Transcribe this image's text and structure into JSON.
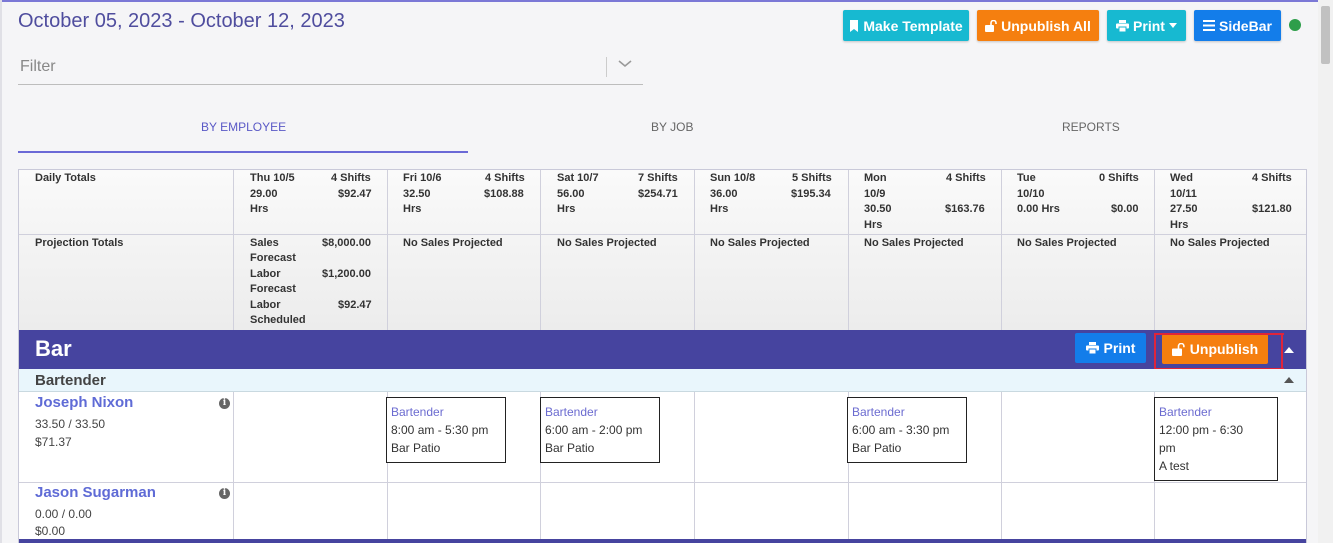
{
  "header": {
    "date_range": "October 05, 2023 - October 12, 2023",
    "buttons": {
      "make_template": "Make Template",
      "unpublish_all": "Unpublish All",
      "print": "Print",
      "sidebar": "SideBar"
    }
  },
  "filter": {
    "placeholder": "Filter"
  },
  "tabs": [
    {
      "label": "BY EMPLOYEE",
      "active": true
    },
    {
      "label": "BY JOB",
      "active": false
    },
    {
      "label": "REPORTS",
      "active": false
    }
  ],
  "daily_totals": {
    "label": "Daily Totals",
    "days": [
      {
        "day": "Thu 10/5",
        "shifts": "4 Shifts",
        "hrs_value": "29.00",
        "hrs_unit": "Hrs",
        "amount": "$92.47"
      },
      {
        "day": "Fri 10/6",
        "shifts": "4 Shifts",
        "hrs_value": "32.50",
        "hrs_unit": "Hrs",
        "amount": "$108.88"
      },
      {
        "day": "Sat 10/7",
        "shifts": "7 Shifts",
        "hrs_value": "56.00",
        "hrs_unit": "Hrs",
        "amount": "$254.71"
      },
      {
        "day": "Sun 10/8",
        "shifts": "5 Shifts",
        "hrs_value": "36.00",
        "hrs_unit": "Hrs",
        "amount": "$195.34"
      },
      {
        "day": "Mon",
        "day2": "10/9",
        "shifts": "4 Shifts",
        "hrs_value": "30.50",
        "hrs_unit": "Hrs",
        "amount": "$163.76"
      },
      {
        "day": "Tue",
        "day2": "10/10",
        "shifts": "0 Shifts",
        "hrs_value": "0.00 Hrs",
        "amount": "$0.00"
      },
      {
        "day": "Wed",
        "day2": "10/11",
        "shifts": "4 Shifts",
        "hrs_value": "27.50",
        "hrs_unit": "Hrs",
        "amount": "$121.80"
      }
    ]
  },
  "projection_totals": {
    "label": "Projection Totals",
    "first_day": {
      "sales_l1": "Sales",
      "sales_l2": "Forecast",
      "sales_value": "$8,000.00",
      "labor_l1": "Labor",
      "labor_l2": "Forecast",
      "labor_value": "$1,200.00",
      "sched_l1": "Labor",
      "sched_l2": "Scheduled",
      "sched_value": "$92.47"
    },
    "no_sales": "No Sales Projected"
  },
  "section": {
    "title": "Bar",
    "print_label": "Print",
    "unpublish_label": "Unpublish",
    "job_title": "Bartender"
  },
  "employees": [
    {
      "name": "Joseph Nixon",
      "hours": "33.50 / 33.50",
      "cost": "$71.37",
      "shifts": [
        {
          "job": "Bartender",
          "time": "8:00 am - 5:30 pm",
          "location": "Bar Patio"
        },
        {
          "job": "Bartender",
          "time": "6:00 am - 2:00 pm",
          "location": "Bar Patio"
        },
        {
          "job": "Bartender",
          "time": "6:00 am - 3:30 pm",
          "location": "Bar Patio"
        },
        {
          "job": "Bartender",
          "time": "12:00 pm - 6:30",
          "time2": "pm",
          "location": "A test"
        }
      ]
    },
    {
      "name": "Jason Sugarman",
      "hours": "0.00 / 0.00",
      "cost": "$0.00",
      "shifts": []
    }
  ],
  "colors": {
    "accent": "#46449f",
    "teal_button": "#17b9d1",
    "orange_button": "#f57f0f",
    "blue_button": "#137dea",
    "status_green": "#2e9e4a"
  }
}
